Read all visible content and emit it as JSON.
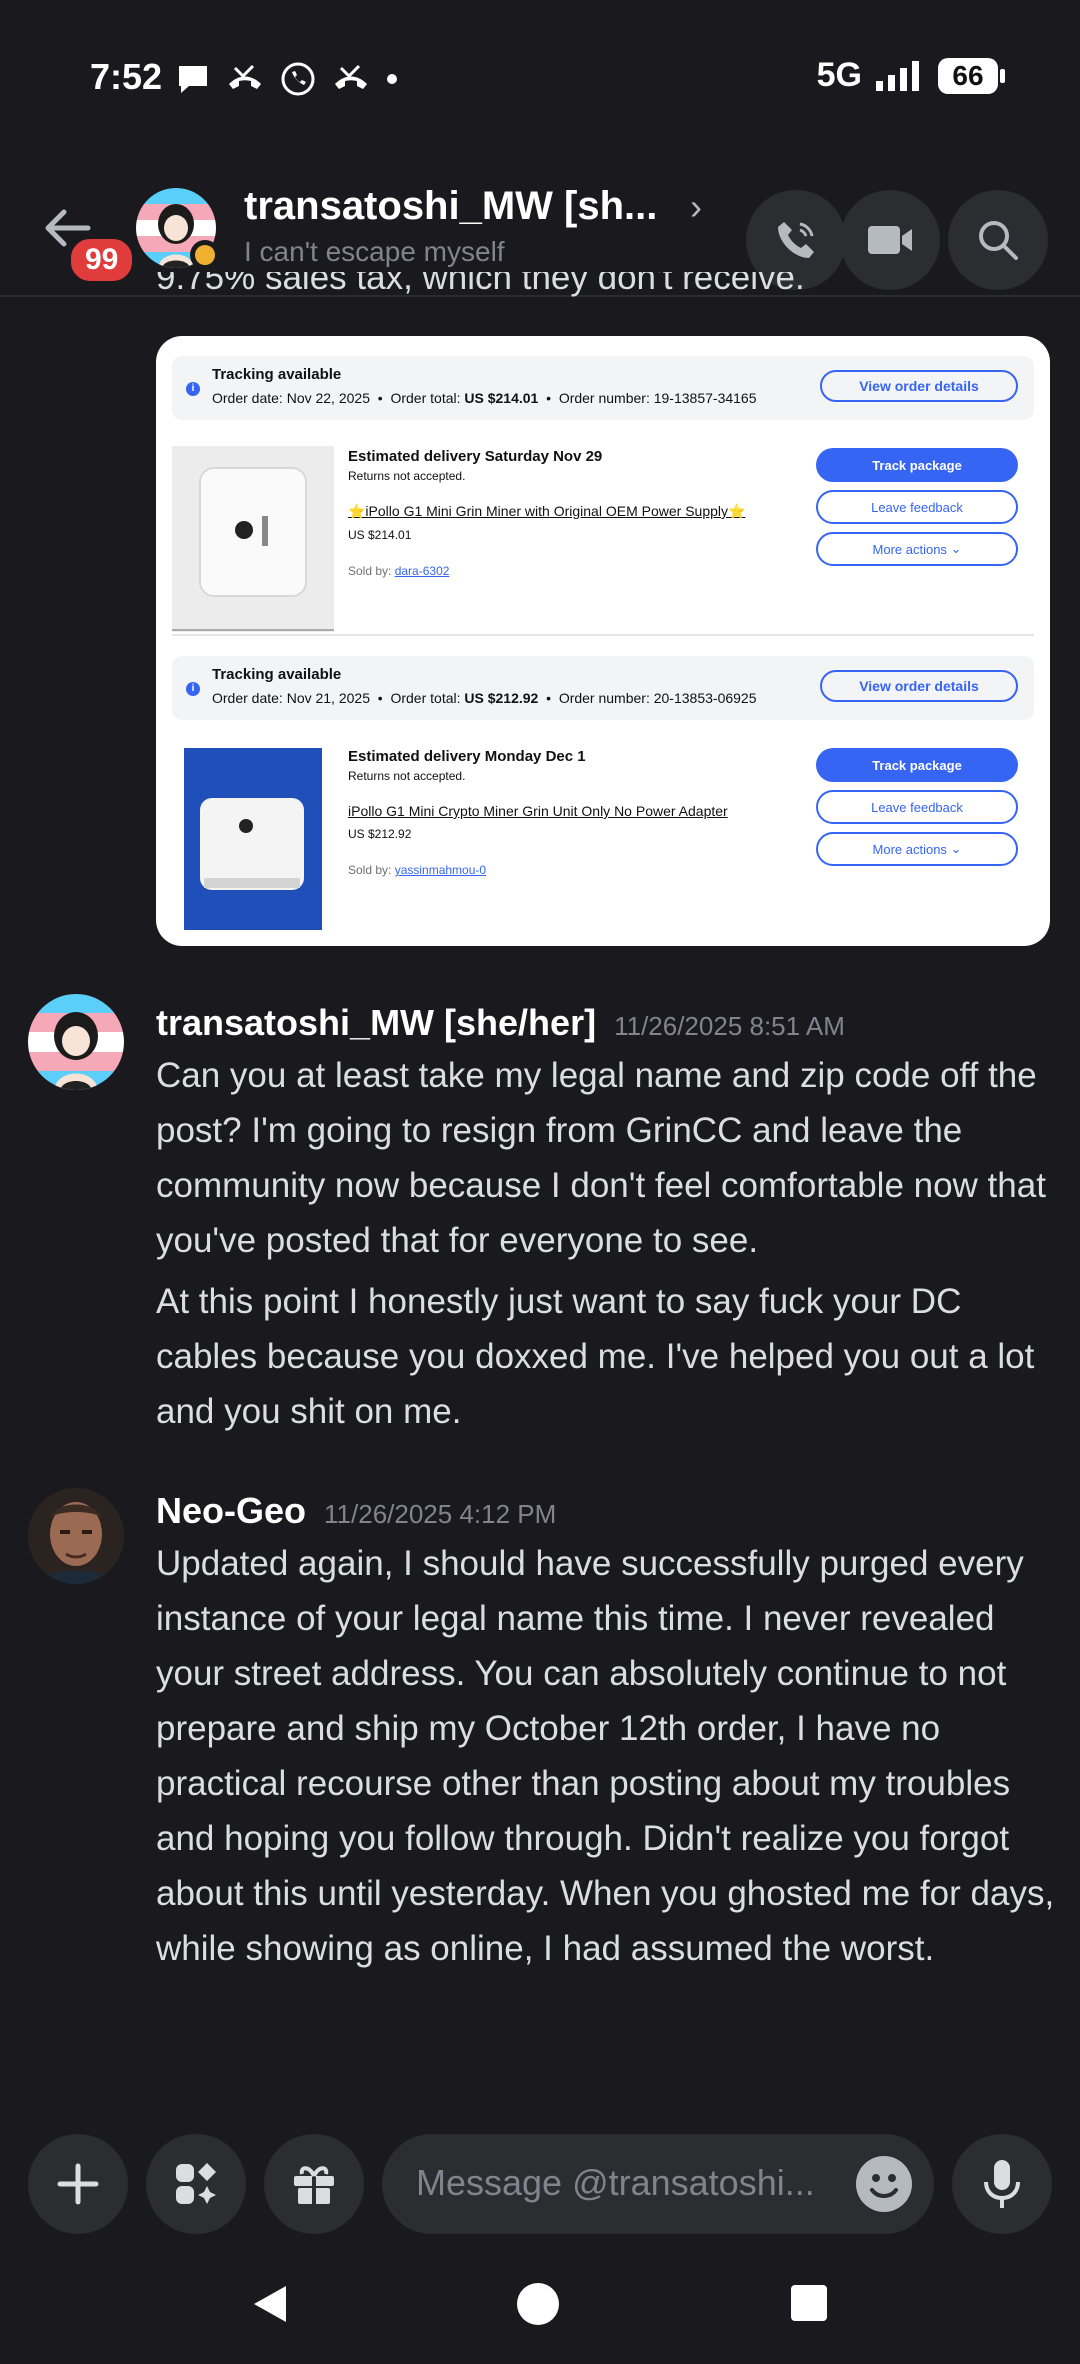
{
  "status_bar": {
    "time": "7:52",
    "network": "5G",
    "battery": "66"
  },
  "header": {
    "unread_count": "99",
    "channel_name": "transatoshi_MW [sh...",
    "subtitle": "I can't escape myself"
  },
  "cut_message": "9.75% sales tax, which they don't receive.",
  "orders": [
    {
      "tracking": "Tracking available",
      "order_date": "Order date: Nov 22, 2025",
      "order_total_label": "Order total: ",
      "order_total": "US $214.01",
      "order_number": "Order number: 19-13857-34165",
      "view_label": "View order details",
      "estimated": "Estimated delivery Saturday Nov 29",
      "returns": "Returns not accepted.",
      "title": "⭐iPollo G1 Mini Grin Miner with Original OEM Power Supply⭐",
      "price": "US $214.01",
      "sold_by": "Sold by: ",
      "seller": "dara-6302",
      "track_label": "Track package",
      "feedback_label": "Leave feedback",
      "more_label": "More actions"
    },
    {
      "tracking": "Tracking available",
      "order_date": "Order date: Nov 21, 2025",
      "order_total_label": "Order total: ",
      "order_total": "US $212.92",
      "order_number": "Order number: 20-13853-06925",
      "view_label": "View order details",
      "estimated": "Estimated delivery Monday Dec 1",
      "returns": "Returns not accepted.",
      "title": "iPollo G1 Mini Crypto Miner Grin Unit Only No Power Adapter",
      "price": "US $212.92",
      "sold_by": "Sold by: ",
      "seller": "yassinmahmou-0",
      "track_label": "Track package",
      "feedback_label": "Leave feedback",
      "more_label": "More actions"
    }
  ],
  "messages": [
    {
      "author": "transatoshi_MW [she/her]",
      "time": "11/26/2025 8:51 AM",
      "paragraphs": [
        "Can you at least take my legal name and zip code off the post? I'm going to resign from GrinCC and leave the community now because I don't feel comfortable now that you've posted that for everyone to see.",
        "At this point I honestly just want to say fuck your DC cables because you doxxed me. I've helped you out a lot and you shit on me."
      ]
    },
    {
      "author": "Neo-Geo",
      "time": "11/26/2025 4:12 PM",
      "paragraphs": [
        "Updated again, I should have successfully purged every instance of your legal name this time. I never revealed your street address. You can absolutely continue to not prepare and ship my October 12th order, I have no practical recourse other than posting about my troubles and hoping you follow through. Didn't realize you forgot about this until yesterday. When you ghosted me for days, while showing as online, I had assumed the worst."
      ]
    }
  ],
  "composer": {
    "placeholder": "Message @transatoshi..."
  },
  "colors": {
    "background": "#1a1a1e",
    "ebay_blue": "#3665f3",
    "badge_red": "#e03c3c",
    "idle_status": "#f0b132"
  }
}
